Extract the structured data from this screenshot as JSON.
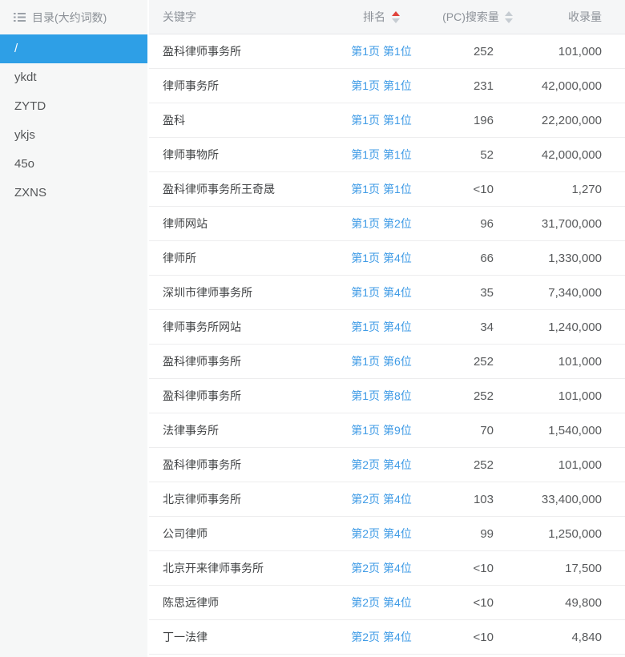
{
  "sidebar": {
    "title": "目录(大约词数)",
    "items": [
      {
        "label": "/",
        "selected": true
      },
      {
        "label": "ykdt",
        "selected": false
      },
      {
        "label": "ZYTD",
        "selected": false
      },
      {
        "label": "ykjs",
        "selected": false
      },
      {
        "label": "45o",
        "selected": false
      },
      {
        "label": "ZXNS",
        "selected": false
      }
    ]
  },
  "table": {
    "columns": {
      "keyword": "关键字",
      "rank": "排名",
      "search_volume": "(PC)搜索量",
      "index_count": "收录量"
    },
    "sort_state": {
      "rank": "ascending-active",
      "search_volume": "inactive"
    },
    "rows": [
      {
        "keyword": "盈科律师事务所",
        "rank": "第1页 第1位",
        "search_volume": "252",
        "index_count": "101,000"
      },
      {
        "keyword": "律师事务所",
        "rank": "第1页 第1位",
        "search_volume": "231",
        "index_count": "42,000,000"
      },
      {
        "keyword": "盈科",
        "rank": "第1页 第1位",
        "search_volume": "196",
        "index_count": "22,200,000"
      },
      {
        "keyword": "律师事物所",
        "rank": "第1页 第1位",
        "search_volume": "52",
        "index_count": "42,000,000"
      },
      {
        "keyword": "盈科律师事务所王奇晟",
        "rank": "第1页 第1位",
        "search_volume": "<10",
        "index_count": "1,270"
      },
      {
        "keyword": "律师网站",
        "rank": "第1页 第2位",
        "search_volume": "96",
        "index_count": "31,700,000"
      },
      {
        "keyword": "律师所",
        "rank": "第1页 第4位",
        "search_volume": "66",
        "index_count": "1,330,000"
      },
      {
        "keyword": "深圳市律师事务所",
        "rank": "第1页 第4位",
        "search_volume": "35",
        "index_count": "7,340,000"
      },
      {
        "keyword": "律师事务所网站",
        "rank": "第1页 第4位",
        "search_volume": "34",
        "index_count": "1,240,000"
      },
      {
        "keyword": "盈科律师事务所",
        "rank": "第1页 第6位",
        "search_volume": "252",
        "index_count": "101,000"
      },
      {
        "keyword": "盈科律师事务所",
        "rank": "第1页 第8位",
        "search_volume": "252",
        "index_count": "101,000"
      },
      {
        "keyword": "法律事务所",
        "rank": "第1页 第9位",
        "search_volume": "70",
        "index_count": "1,540,000"
      },
      {
        "keyword": "盈科律师事务所",
        "rank": "第2页 第4位",
        "search_volume": "252",
        "index_count": "101,000"
      },
      {
        "keyword": "北京律师事务所",
        "rank": "第2页 第4位",
        "search_volume": "103",
        "index_count": "33,400,000"
      },
      {
        "keyword": "公司律师",
        "rank": "第2页 第4位",
        "search_volume": "99",
        "index_count": "1,250,000"
      },
      {
        "keyword": "北京开来律师事务所",
        "rank": "第2页 第4位",
        "search_volume": "<10",
        "index_count": "17,500"
      },
      {
        "keyword": "陈思远律师",
        "rank": "第2页 第4位",
        "search_volume": "<10",
        "index_count": "49,800"
      },
      {
        "keyword": "丁一法律",
        "rank": "第2页 第4位",
        "search_volume": "<10",
        "index_count": "4,840"
      }
    ]
  },
  "colors": {
    "accent_blue": "#2e9fe6",
    "link_blue": "#3f9be6",
    "sort_active_red": "#e0433c",
    "sort_inactive_gray": "#c6ccd2",
    "selected_item_text": "#ffffff"
  }
}
